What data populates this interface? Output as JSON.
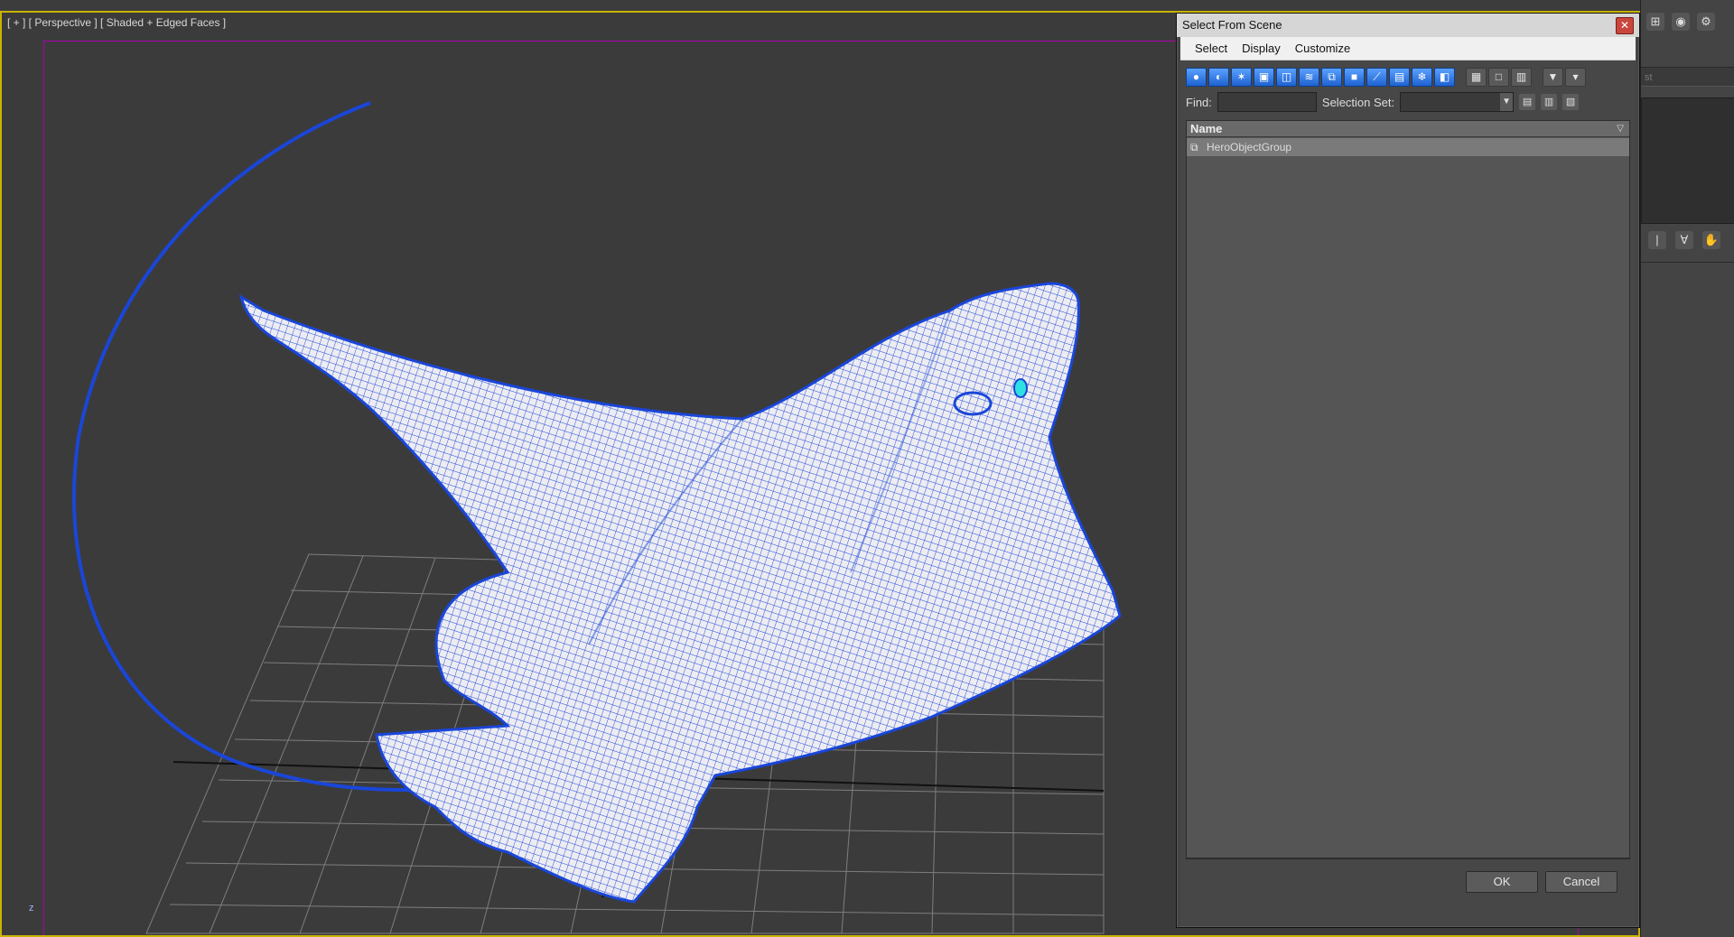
{
  "viewport": {
    "label": "[ + ] [ Perspective ] [ Shaded + Edged Faces ]",
    "axis_label": "z",
    "colors": {
      "mesh_fill": "#ececf2",
      "wireframe": "#1a46d8",
      "frame": "#b000b0",
      "active_border": "#c8b400",
      "eye": "#2fe0e0"
    }
  },
  "dialog": {
    "title": "Select From Scene",
    "close_icon": "close-icon",
    "menu": [
      "Select",
      "Display",
      "Customize"
    ],
    "toolbar_icons": [
      "display-geometry-icon",
      "display-shapes-icon",
      "display-lights-icon",
      "display-cameras-icon",
      "display-helpers-icon",
      "display-spacewarps-icon",
      "display-groups-icon",
      "display-xrefs-icon",
      "display-bones-icon",
      "display-containers-icon",
      "display-frozen-icon",
      "display-hidden-icon",
      "select-all-icon",
      "select-none-icon",
      "select-invert-icon",
      "filter-icon",
      "filter-options-icon"
    ],
    "find_label": "Find:",
    "find_value": "",
    "selection_set_label": "Selection Set:",
    "selection_set_value": "",
    "list": {
      "header": "Name",
      "sort_icon": "sort-icon",
      "rows": [
        {
          "icon": "group-icon",
          "name": "HeroObjectGroup",
          "selected": true
        }
      ]
    },
    "ok_label": "OK",
    "cancel_label": "Cancel"
  },
  "command_panel": {
    "field_text": "st",
    "top_icons": [
      "hierarchy-icon",
      "motion-icon",
      "utility-icon"
    ],
    "row_icons": [
      "pin-icon",
      "unique-icon",
      "hand-icon"
    ]
  }
}
